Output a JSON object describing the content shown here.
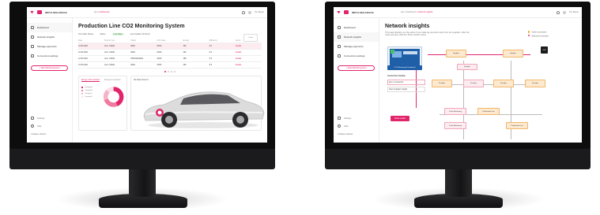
{
  "brand": {
    "name": "IMPULSEGARAGE",
    "accent": "#e2246b"
  },
  "left_screen": {
    "topbar": {
      "breadcrumb_root": "App /",
      "breadcrumb_current": "Dashboard",
      "user": "Tim Meyer"
    },
    "sidebar": {
      "items": [
        {
          "label": "Dashboard",
          "icon": "grid-icon"
        },
        {
          "label": "Network insights",
          "icon": "network-icon"
        },
        {
          "label": "Manage payments",
          "icon": "card-icon"
        },
        {
          "label": "Connectors settings",
          "icon": "plug-icon"
        }
      ],
      "new_button": "+ New Monitoring Item",
      "bottom": [
        {
          "label": "Settings",
          "icon": "gear-icon"
        },
        {
          "label": "Help",
          "icon": "help-icon"
        },
        {
          "label": "Collapse sidebar",
          "icon": "collapse-icon"
        }
      ]
    },
    "title": "Production Line CO2 Monitoring System",
    "filters": {
      "sort": "Sort table  Status",
      "status_label": "Status",
      "status_value": "Live Data",
      "last_update": "Last Update  15:40min"
    },
    "corner_card": "Trends",
    "table": {
      "headers": [
        "Date",
        "Monitor item",
        "Status",
        "CO2 value",
        "Energy",
        "Efficiency",
        "Action"
      ],
      "rows": [
        [
          "12.05.2022",
          "Item 1 NEW",
          "NEW",
          "250%",
          "452",
          "8.0",
          "Details"
        ],
        [
          "12.05.2022",
          "Item 1 NEW",
          "NEW",
          "250%",
          "452",
          "8.0",
          "Details"
        ],
        [
          "12.05.2022",
          "Item 1 NEW",
          "PROCESSING",
          "320%",
          "389",
          "8.3",
          "Details"
        ],
        [
          "12.05.2022",
          "Item 2 NEW",
          "NEW",
          "250%",
          "452",
          "8.6",
          "Details"
        ]
      ]
    },
    "lower_tabs": [
      "Energy CO2 emission",
      "Energy % emission"
    ],
    "donut_legend": [
      "Category A",
      "Category B",
      "Category C",
      "Category D"
    ],
    "car_card_title": "3D Model Tesla S"
  },
  "right_screen": {
    "topbar": {
      "breadcrumb_root": "App /",
      "breadcrumb_mid": "Dashboard /",
      "breadcrumb_current": "Network insights",
      "user": "Tim Meyer"
    },
    "sidebar": {
      "items": [
        {
          "label": "Dashboard",
          "icon": "grid-icon"
        },
        {
          "label": "Network insights",
          "icon": "network-icon"
        },
        {
          "label": "Manage payments",
          "icon": "card-icon"
        },
        {
          "label": "Connectors settings",
          "icon": "plug-icon"
        }
      ],
      "new_button": "+ New Monitoring Item",
      "bottom": [
        {
          "label": "Settings",
          "icon": "gear-icon"
        },
        {
          "label": "Help",
          "icon": "help-icon"
        },
        {
          "label": "Collapse sidebar",
          "icon": "collapse-icon"
        }
      ]
    },
    "title": "Network insights",
    "subtitle": "This page displays you the paths of your data sig-nal cell-in-level from the suppliers. After the node overview, click the 'Show results' button.",
    "legend": [
      {
        "label": "Active connection",
        "color": "#f5a623"
      },
      {
        "label": "Selected connection",
        "color": "#e2246b"
      }
    ],
    "diagram": {
      "main_node": "CO2 Monitoring Dashboard",
      "connection_title": "Connection timeline",
      "connections": [
        "Item 1 Connector",
        "Open Supplier Insight"
      ],
      "tool_button": "Show results",
      "nodes_top": [
        "Supplier",
        "Supplier",
        "Supplier"
      ],
      "nodes_mid": [
        "Provider",
        "Provider",
        "Provider",
        "Provider"
      ],
      "nodes_bottom": [
        "Tesla Monitoring",
        "Production Line",
        "Tesla Monitoring",
        "Production Line"
      ],
      "badge": "SUP"
    }
  }
}
